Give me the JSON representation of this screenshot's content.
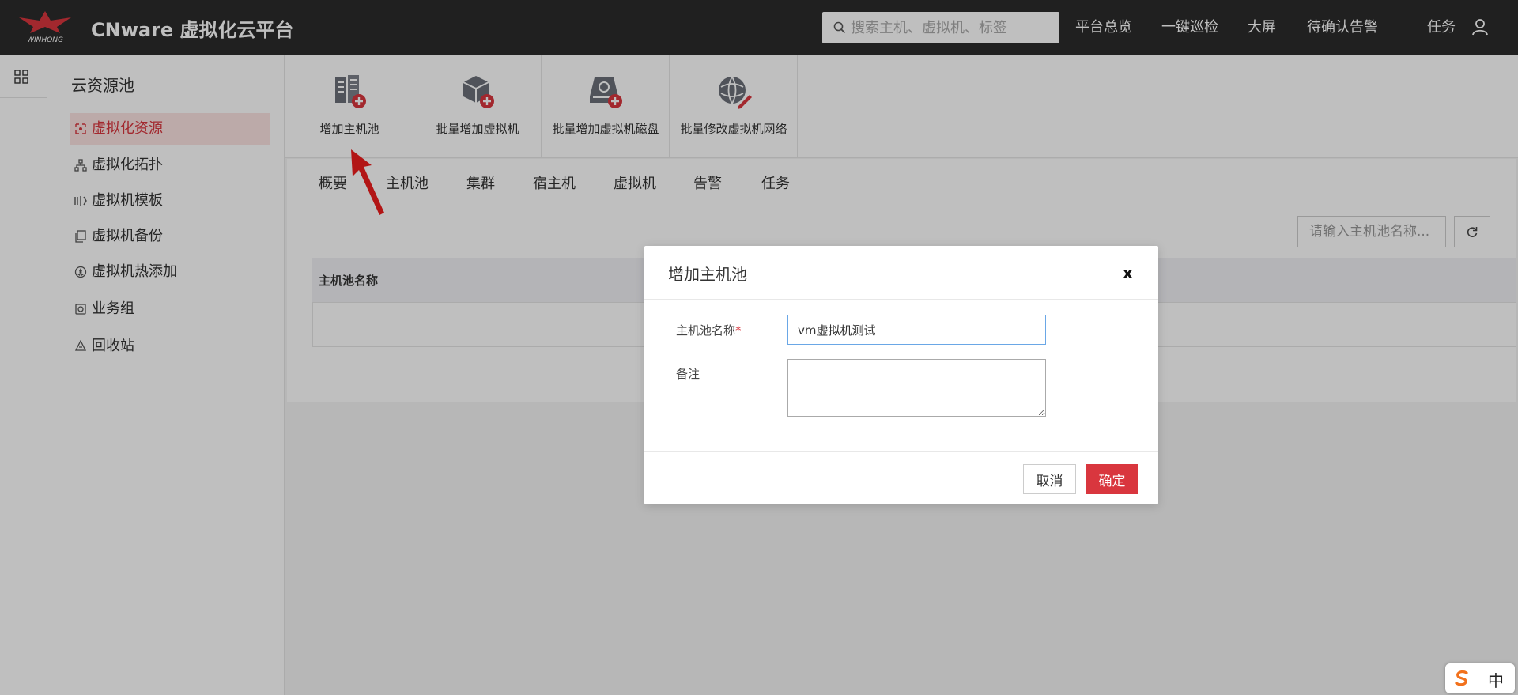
{
  "header": {
    "brand_text": "WINHONG",
    "app_title": "CNware 虚拟化云平台",
    "search_placeholder": "搜索主机、虚拟机、标签",
    "nav": [
      "平台总览",
      "一键巡检",
      "大屏",
      "待确认告警"
    ],
    "tasks_label": "任务"
  },
  "sidebar": {
    "title": "云资源池",
    "items": [
      {
        "label": "虚拟化资源",
        "icon": "resource-icon",
        "active": true
      },
      {
        "label": "虚拟化拓扑",
        "icon": "topology-icon"
      },
      {
        "label": "虚拟机模板",
        "icon": "template-icon"
      },
      {
        "label": "虚拟机备份",
        "icon": "backup-icon"
      },
      {
        "label": "虚拟机热添加",
        "icon": "hot-add-icon"
      },
      {
        "label": "业务组",
        "icon": "business-group-icon"
      },
      {
        "label": "回收站",
        "icon": "recycle-bin-icon"
      }
    ]
  },
  "toolbar": {
    "items": [
      {
        "label": "增加主机池",
        "icon": "host-pool-add-icon"
      },
      {
        "label": "批量增加虚拟机",
        "icon": "vm-add-icon"
      },
      {
        "label": "批量增加虚拟机磁盘",
        "icon": "disk-add-icon"
      },
      {
        "label": "批量修改虚拟机网络",
        "icon": "network-edit-icon"
      }
    ]
  },
  "tabs": [
    "概要",
    "主机池",
    "集群",
    "宿主机",
    "虚拟机",
    "告警",
    "任务"
  ],
  "content": {
    "filter_placeholder": "请输入主机池名称...",
    "table_header": "主机池名称"
  },
  "modal": {
    "title": "增加主机池",
    "close_label": "x",
    "name_label": "主机池名称",
    "required_mark": "*",
    "name_value": "vm虚拟机测试",
    "remark_label": "备注",
    "remark_value": "",
    "cancel_label": "取消",
    "ok_label": "确定"
  },
  "ime": {
    "label": "中"
  },
  "colors": {
    "topbar": "#2b2b2b",
    "accent": "#d9363e",
    "active_bg": "#fbe3e2",
    "input_focus": "#6aa7e6"
  }
}
